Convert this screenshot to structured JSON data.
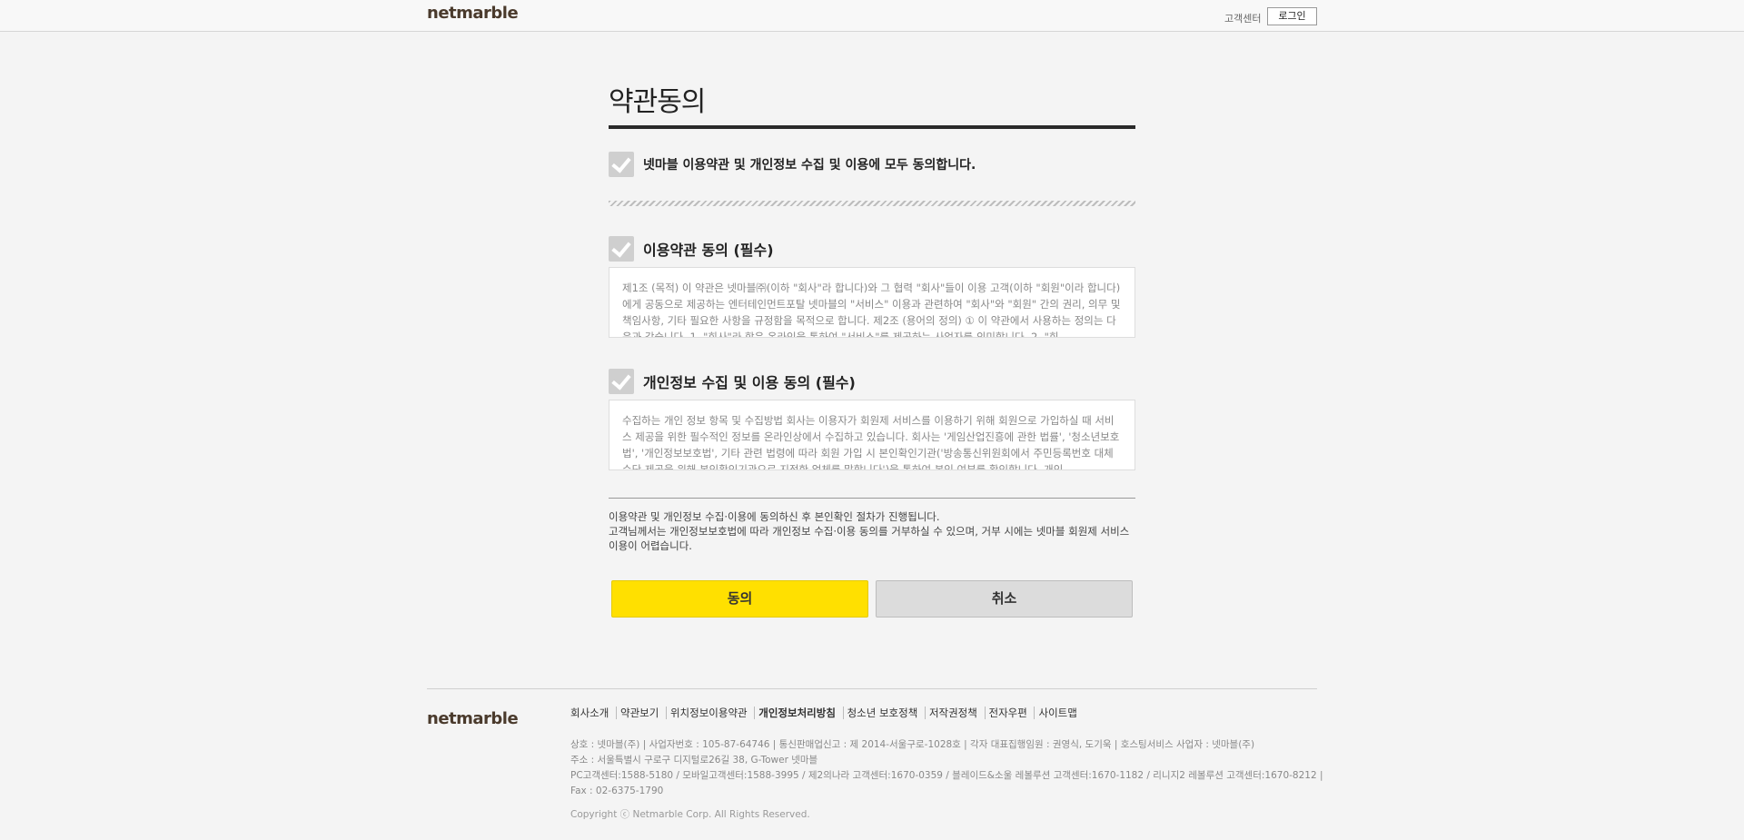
{
  "header": {
    "logo": "netmarble",
    "customer_center": "고객센터",
    "login": "로그인"
  },
  "main": {
    "title": "약관동의",
    "agree_all": "넷마블 이용약관 및 개인정보 수집 및 이용에 모두 동의합니다.",
    "terms_label": "이용약관 동의 (필수)",
    "terms_text": "제1조 (목적) 이 약관은 넷마블㈜(이하 \"회사\"라 합니다)와 그 협력 \"회사\"들이 이용 고객(이하 \"회원\"이라 합니다)에게 공동으로 제공하는 엔터테인먼트포탈 넷마블의 \"서비스\" 이용과 관련하여 \"회사\"와 \"회원\" 간의 권리, 의무 및 책임사항, 기타 필요한 사항을 규정함을 목적으로 합니다. 제2조 (용어의 정의) ① 이 약관에서 사용하는 정의는 다음과 같습니다. 1. \"회사\"라 함은 온라인을 통하여 \"서비스\"를 제공하는 사업자를 의미합니다. 2. \"회",
    "privacy_label": "개인정보 수집 및 이용 동의 (필수)",
    "privacy_text": "수집하는 개인 정보 항목 및 수집방법 회사는 이용자가 회원제 서비스를 이용하기 위해 회원으로 가입하실 때 서비스 제공을 위한 필수적인 정보를 온라인상에서 수집하고 있습니다. 회사는 '게임산업진흥에 관한 법률', '청소년보호법', '개인정보보호법', 기타 관련 법령에 따라 회원 가입 시 본인확인기관('방송통신위원회에서 주민등록번호 대체수단 제공을 위해 본인확인기관으로 지정한 업체를 말합니다')을 통하여 본인 여부를 확인합니다. 개인",
    "notice_line1": "이용약관 및 개인정보 수집·이용에 동의하신 후 본인확인 절차가 진행됩니다.",
    "notice_line2": "고객님께서는 개인정보보호법에 따라 개인정보 수집·이용 동의를 거부하실 수 있으며, 거부 시에는 넷마블 회원제 서비스 이용이 어렵습니다.",
    "agree_button": "동의",
    "cancel_button": "취소"
  },
  "footer": {
    "logo": "netmarble",
    "links": [
      "회사소개",
      "약관보기",
      "위치정보이용약관",
      "개인정보처리방침",
      "청소년 보호정책",
      "저작권정책",
      "전자우편",
      "사이트맵"
    ],
    "info_line1": "상호 : 넷마블(주) | 사업자번호 : 105-87-64746 | 통신판매업신고 : 제 2014-서울구로-1028호 | 각자 대표집행임원 : 권영식, 도기욱 | 호스팅서비스 사업자 : 넷마블(주)",
    "info_line2": "주소 : 서울특별시 구로구 디지털로26길 38, G-Tower 넷마블",
    "info_line3": "PC고객센터:1588-5180 / 모바일고객센터:1588-3995 / 제2의나라 고객센터:1670-0359 / 블레이드&소울 레볼루션 고객센터:1670-1182 / 리니지2 레볼루션 고객센터:1670-8212 |",
    "info_line4": "Fax : 02-6375-1790",
    "copyright": "Copyright ⓒ Netmarble Corp. All Rights Reserved."
  }
}
